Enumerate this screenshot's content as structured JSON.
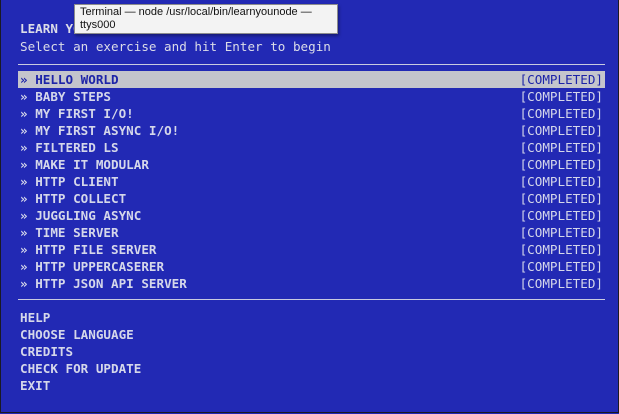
{
  "tooltip": {
    "line1": "Terminal — node /usr/local/bin/learnyounode —",
    "line2": "ttys000"
  },
  "header": {
    "title": "LEARN YOU THE NODE.JS FOR MUCH WIN!",
    "subtitle": "Select an exercise and hit Enter to begin"
  },
  "menu": {
    "marker": "»",
    "items": [
      {
        "label": "HELLO WORLD",
        "status": "[COMPLETED]"
      },
      {
        "label": "BABY STEPS",
        "status": "[COMPLETED]"
      },
      {
        "label": "MY FIRST I/O!",
        "status": "[COMPLETED]"
      },
      {
        "label": "MY FIRST ASYNC I/O!",
        "status": "[COMPLETED]"
      },
      {
        "label": "FILTERED LS",
        "status": "[COMPLETED]"
      },
      {
        "label": "MAKE IT MODULAR",
        "status": "[COMPLETED]"
      },
      {
        "label": "HTTP CLIENT",
        "status": "[COMPLETED]"
      },
      {
        "label": "HTTP COLLECT",
        "status": "[COMPLETED]"
      },
      {
        "label": "JUGGLING ASYNC",
        "status": "[COMPLETED]"
      },
      {
        "label": "TIME SERVER",
        "status": "[COMPLETED]"
      },
      {
        "label": "HTTP FILE SERVER",
        "status": "[COMPLETED]"
      },
      {
        "label": "HTTP UPPERCASERER",
        "status": "[COMPLETED]"
      },
      {
        "label": "HTTP JSON API SERVER",
        "status": "[COMPLETED]"
      }
    ]
  },
  "options": {
    "help": "HELP",
    "choose_language": "CHOOSE LANGUAGE",
    "credits": "CREDITS",
    "check_update": "CHECK FOR UPDATE",
    "exit": "EXIT"
  },
  "colors": {
    "background": "#2229b4",
    "selected_bg": "#c4c5cc",
    "selected_fg": "#1d24a8",
    "text": "#d5d7ea"
  }
}
